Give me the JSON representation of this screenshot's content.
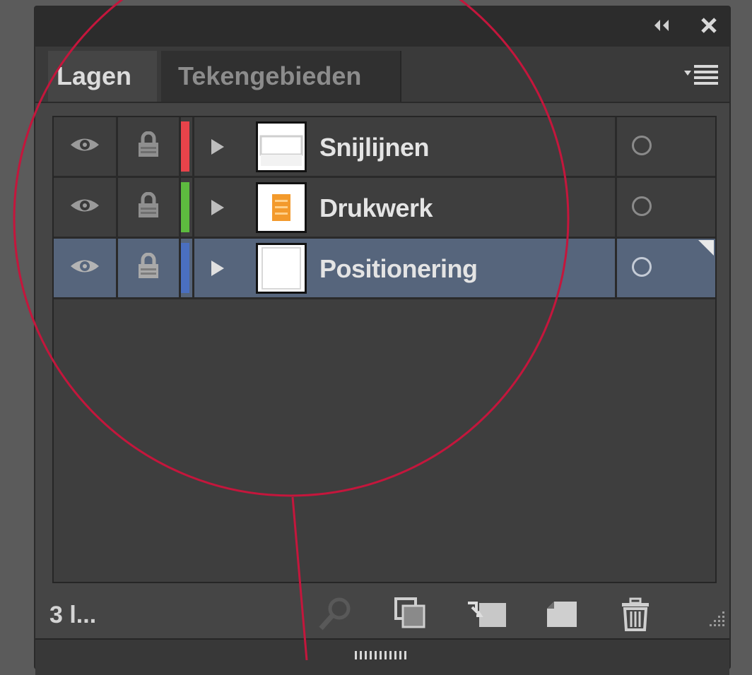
{
  "panel": {
    "collapse_icon": "double-chevron-left-icon",
    "close_icon": "close-icon",
    "tabs": [
      {
        "label": "Lagen",
        "active": true
      },
      {
        "label": "Tekengebieden",
        "active": false
      }
    ],
    "menu_icon": "panel-menu-icon"
  },
  "layers": [
    {
      "name": "Snijlijnen",
      "color": "#e8434a",
      "selected": false,
      "visible": true,
      "locked": false
    },
    {
      "name": "Drukwerk",
      "color": "#5dbb3f",
      "selected": false,
      "visible": true,
      "locked": false
    },
    {
      "name": "Positionering",
      "color": "#4a6fc0",
      "selected": true,
      "visible": true,
      "locked": false
    }
  ],
  "footer": {
    "count": "3 l...",
    "buttons": [
      "locate-object-icon",
      "make-clipping-mask-icon",
      "create-sublayer-icon",
      "create-new-layer-icon",
      "delete-layer-icon"
    ]
  },
  "colors": {
    "panel_bg": "#454545",
    "selected_row": "#56657c",
    "annotation": "#c4163c"
  }
}
